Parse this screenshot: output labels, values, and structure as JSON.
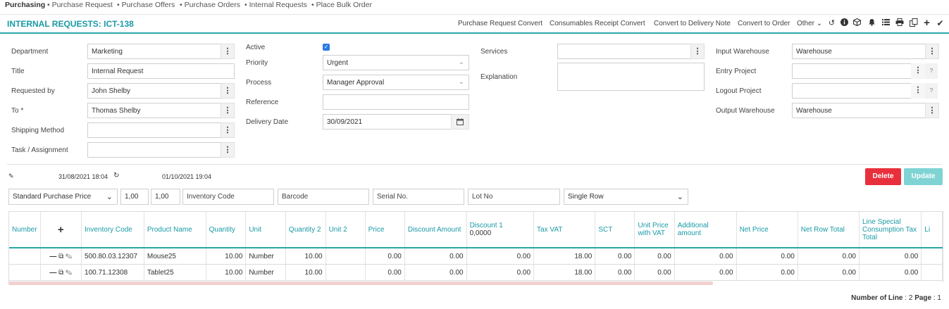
{
  "topnav": {
    "items": [
      "Purchasing",
      "• Purchase Request",
      "• Purchase Offers",
      "• Purchase Orders",
      "• Internal Requests",
      "• Place Bulk Order"
    ]
  },
  "header": {
    "title": "INTERNAL REQUESTS: ICT-138",
    "actions": [
      "Purchase Request Convert",
      "Consumables Receipt Convert",
      "Convert to Delivery Note",
      "Convert to Order"
    ],
    "other": "Other",
    "icons": [
      "history-icon",
      "info-icon",
      "cube-icon",
      "bell-icon",
      "list-icon",
      "print-icon",
      "copy-icon",
      "plus-icon",
      "check-icon"
    ]
  },
  "form": {
    "department": {
      "label": "Department",
      "value": "Marketing"
    },
    "title": {
      "label": "Title",
      "value": "Internal Request"
    },
    "requested_by": {
      "label": "Requested by",
      "value": "John Shelby"
    },
    "to": {
      "label": "To *",
      "value": "Thomas Shelby"
    },
    "shipping_method": {
      "label": "Shipping Method",
      "value": ""
    },
    "task": {
      "label": "Task / Assignment",
      "value": ""
    },
    "active": {
      "label": "Active",
      "checked": true
    },
    "priority": {
      "label": "Priority",
      "value": "Urgent"
    },
    "process": {
      "label": "Process",
      "value": "Manager Approval"
    },
    "reference": {
      "label": "Reference",
      "value": ""
    },
    "delivery_date": {
      "label": "Delivery Date",
      "value": "30/09/2021"
    },
    "services": {
      "label": "Services",
      "value": ""
    },
    "explanation": {
      "label": "Explanation",
      "value": ""
    },
    "input_warehouse": {
      "label": "Input Warehouse",
      "value": "Warehouse"
    },
    "entry_project": {
      "label": "Entry Project",
      "value": ""
    },
    "logout_project": {
      "label": "Logout Project",
      "value": ""
    },
    "output_warehouse": {
      "label": "Output Warehouse",
      "value": "Warehouse"
    },
    "help": "?"
  },
  "meta": {
    "created": "31/08/2021 18:04",
    "updated": "01/10/2021 19:04"
  },
  "buttons": {
    "delete": "Delete",
    "update": "Update"
  },
  "colors": {
    "accent": "#1a9aa5",
    "delete": "#e8303c",
    "update": "#7fd3d3"
  },
  "filters": {
    "price_type": "Standard Purchase Price",
    "qty1": "1,00",
    "qty2": "1,00",
    "inventory_code_placeholder": "Inventory Code",
    "barcode_placeholder": "Barcode",
    "serial_placeholder": "Serial No.",
    "lot_placeholder": "Lot No",
    "row_mode": "Single Row"
  },
  "table": {
    "columns": [
      "Number",
      "",
      "Inventory Code",
      "Product Name",
      "Quantity",
      "Unit",
      "Quantity 2",
      "Unit 2",
      "Price",
      "Discount Amount",
      "Discount 1",
      "Tax VAT",
      "SCT",
      "Unit Price with VAT",
      "Additional amount",
      "Net Price",
      "Net Row Total",
      "Line Special Consumption Tax Total",
      "Li"
    ],
    "discount_sub": "0,0000",
    "rows": [
      [
        "",
        "",
        "500.80.03.12307",
        "Mouse25",
        "10.00",
        "Number",
        "10.00",
        "",
        "0.00",
        "0.00",
        "0.00",
        "18.00",
        "0.00",
        "0.00",
        "0.00",
        "0.00",
        "0.00",
        "0.00",
        ""
      ],
      [
        "",
        "",
        "100.71.12308",
        "Tablet25",
        "10.00",
        "Number",
        "10.00",
        "",
        "0.00",
        "0.00",
        "0.00",
        "18.00",
        "0.00",
        "0.00",
        "0.00",
        "0.00",
        "0.00",
        "0.00",
        ""
      ]
    ]
  },
  "footer": {
    "lines_label": "Number of Line",
    "lines_value": ": 2",
    "page_label": "Page",
    "page_value": ": 1"
  }
}
